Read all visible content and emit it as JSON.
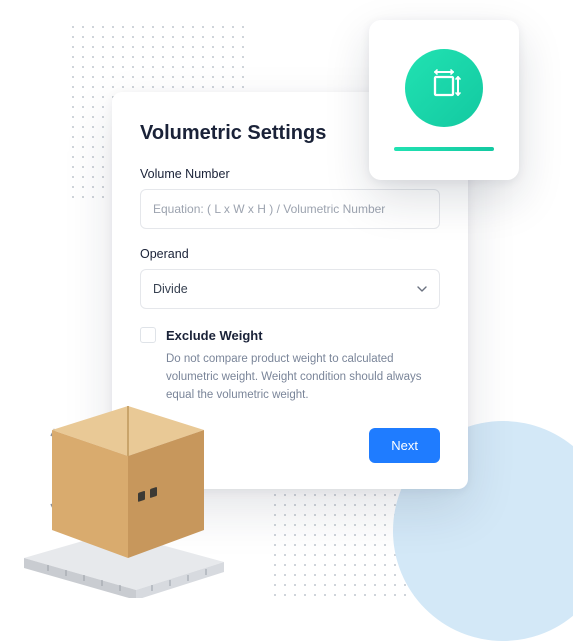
{
  "card": {
    "title": "Volumetric Settings",
    "volume_label": "Volume Number",
    "volume_placeholder": "Equation: ( L x W x H ) / Volumetric Number",
    "operand_label": "Operand",
    "operand_value": "Divide",
    "exclude_label": "Exclude Weight",
    "exclude_hint": "Do not compare product weight to calculated volumetric weight. Weight condition should always equal the volumetric weight.",
    "next_label": "Next"
  },
  "colors": {
    "accent": "#1f7cff",
    "brand_green": "#18d6a8"
  }
}
